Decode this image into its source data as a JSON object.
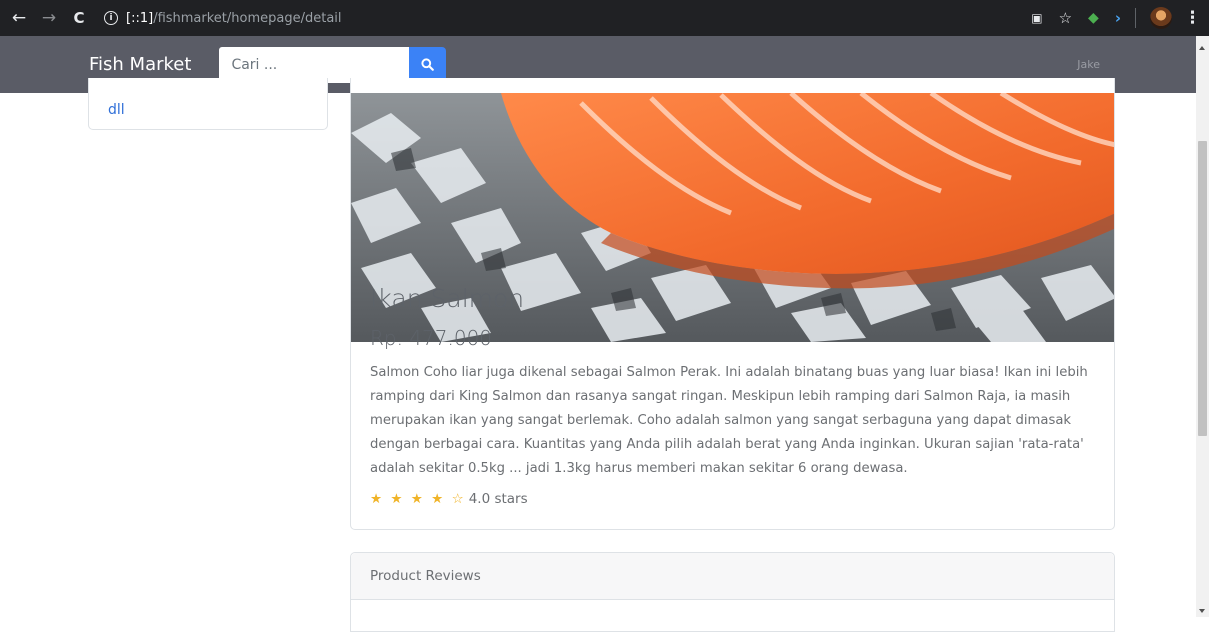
{
  "browser": {
    "url_host": "[::1]",
    "url_path": "/fishmarket/homepage/detail",
    "icons": [
      "back-arrow-icon",
      "forward-arrow-icon",
      "reload-icon",
      "info-icon",
      "translate-icon",
      "star-icon",
      "extension-icon",
      "extension-arrow-icon",
      "profile-avatar",
      "menu-kebab-icon"
    ]
  },
  "navbar": {
    "brand": "Fish Market",
    "search_placeholder": "Cari ...",
    "user": "Jake",
    "accent": "#3b82f6",
    "background": "#5a5c66"
  },
  "sidebar": {
    "items": [
      {
        "label": "dll"
      }
    ]
  },
  "product": {
    "title": "Ikan Salmon",
    "price": "Rp. 477.000",
    "description": "Salmon Coho liar juga dikenal sebagai Salmon Perak. Ini adalah binatang buas yang luar biasa! Ikan ini lebih ramping dari King Salmon dan rasanya sangat ringan. Meskipun lebih ramping dari Salmon Raja, ia masih merupakan ikan yang sangat berlemak. Coho adalah salmon yang sangat serbaguna yang dapat dimasak dengan berbagai cara. Kuantitas yang Anda pilih adalah berat yang Anda inginkan. Ukuran sajian 'rata-rata' adalah sekitar 0.5kg ... jadi 1.3kg harus memberi makan sekitar 6 orang dewasa.",
    "stars": "★ ★ ★ ★ ☆",
    "rating_value": 4,
    "rating_max": 5,
    "rating_text": "4.0 stars",
    "star_color": "#f0b429"
  },
  "reviews": {
    "header": "Product Reviews"
  }
}
